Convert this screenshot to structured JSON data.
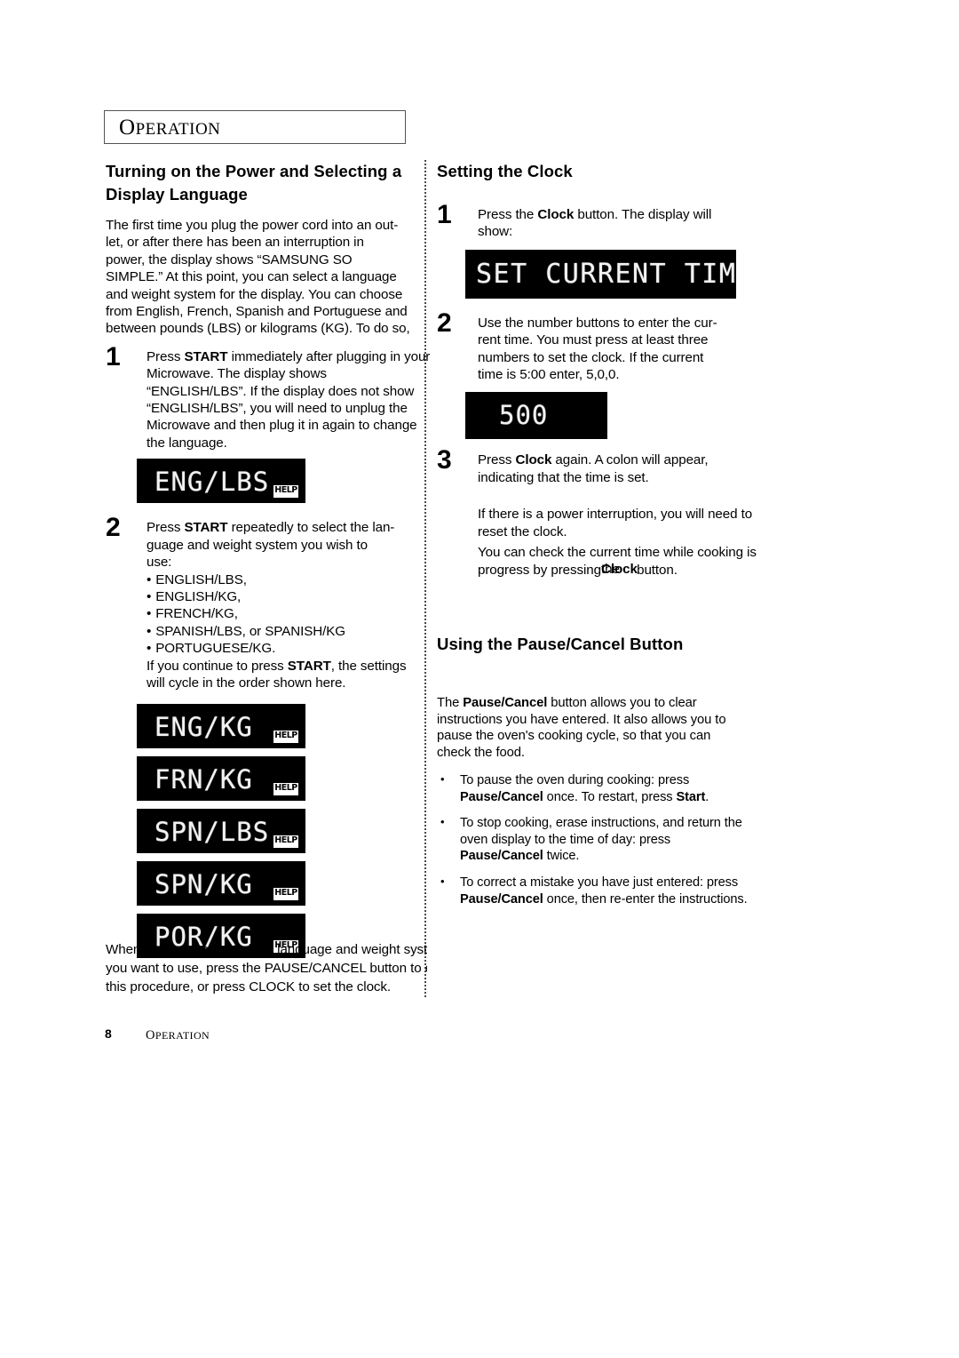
{
  "page": {
    "section_banner": "OPERATION",
    "footer_page_number": "8",
    "footer_section": "OPERATION"
  },
  "left_column": {
    "heading": "Turning on the Power and Selecting a Display Language",
    "intro_paragraph": "The first time you plug the power cord into an outlet, or after there has been an interruption in power, the display shows “SAMSUNG SO SIMPLE.” At this point, you can select a language and weight system for the display. You can choose from English, French, Spanish and Portuguese and between pounds (LBS) or kilograms (KG). To do so,",
    "intro_lines": [
      "The first time you plug the power cord into an out-",
      "let, or after there has been an interruption in",
      "power, the display shows “SAMSUNG SO",
      "SIMPLE.” At this point, you can select a language",
      "and weight system for the display. You can choose",
      "from English, French, Spanish and Portuguese and",
      "between pounds (LBS) or kilograms (KG). To do so,"
    ],
    "step1": {
      "number": "1",
      "line1_pre": "Press ",
      "line1_bold": "START",
      "line1_post": " immediately after plugging in your",
      "lines_rest": [
        "Microwave. The display shows",
        "“ENGLISH/LBS”. If the display does not show",
        "“ENGLISH/LBS”, you will need to unplug the",
        "Microwave and then plug it in again to change",
        "the language."
      ],
      "display": {
        "text": "ENG/LBS",
        "badge": "HELP"
      }
    },
    "step2": {
      "number": "2",
      "line1_pre": "Press ",
      "line1_bold": "START",
      "line1_post": " repeatedly to select the lan-",
      "lines_rest": [
        "guage and weight system you wish to",
        "use:"
      ],
      "options": [
        "ENGLISH/LBS,",
        "ENGLISH/KG,",
        "FRENCH/KG,",
        "SPANISH/LBS, or  SPANISH/KG",
        "PORTUGUESE/KG."
      ],
      "cycle_note_pre": "If you continue to press ",
      "cycle_note_bold": "START",
      "cycle_note_post": ", the settings",
      "cycle_note_line2": "will cycle in the order shown here.",
      "displays": [
        {
          "text": "ENG/KG",
          "badge": "HELP"
        },
        {
          "text": "FRN/KG",
          "badge": "HELP"
        },
        {
          "text": "SPN/LBS",
          "badge": "HELP"
        },
        {
          "text": "SPN/KG",
          "badge": "HELP"
        },
        {
          "text": "POR/KG",
          "badge": "HELP"
        }
      ]
    },
    "closing_lines": [
      "When you have selected the language and weight system",
      "you want to use, press the PAUSE/CANCEL button to end",
      "this procedure, or press CLOCK to set the clock."
    ]
  },
  "right_column": {
    "clock_section": {
      "heading": "Setting the Clock",
      "step1": {
        "number": "1",
        "line1_pre": "Press the ",
        "line1_bold": "Clock",
        "line1_post": " button.  The display will",
        "line2": "show:",
        "display": {
          "text": "SET CURRENT TIME"
        }
      },
      "step2": {
        "number": "2",
        "lines": [
          "Use the number buttons to enter the cur-",
          "rent time. You must press at least three",
          "numbers to set the clock. If the current",
          "time is 5:00 enter, 5,0,0."
        ],
        "display": {
          "text": "500"
        }
      },
      "step3": {
        "number": "3",
        "line1_pre": "Press ",
        "line1_bold": "Clock",
        "line1_post": " again. A colon will appear,",
        "line2": "indicating that the time is set."
      },
      "note_lines": [
        "If there is a power interruption, you will need to",
        "reset the clock."
      ],
      "check_line1": "You can check the current time while cooking is",
      "check_line2_pre": "progress by pressing",
      "check_overlap_a": "the",
      "check_overlap_b": "Clock",
      "check_line2_post": " button."
    },
    "pause_section": {
      "heading": "Using the Pause/Cancel Button",
      "intro_pre": "The ",
      "intro_bold": "Pause/Cancel",
      "intro_post": " button allows you to clear",
      "intro_lines_rest": [
        "instructions you have entered.  It also allows you to",
        "pause the oven's cooking cycle, so that you can",
        "check the food."
      ],
      "bullets": [
        {
          "line1": "To pause the oven during cooking: press",
          "line2_bold1": "Pause/Cancel",
          "line2_mid": " once. To restart, press ",
          "line2_bold2": "Start",
          "line2_post": "."
        },
        {
          "line1": "To stop cooking, erase instructions, and return the",
          "line2": "oven display to the time of day: press",
          "line3_bold": "Pause/Cancel",
          "line3_post": " twice."
        },
        {
          "line1": "To correct a mistake you have just entered: press",
          "line2_bold": "Pause/Cancel",
          "line2_post": " once, then re-enter the instructions."
        }
      ]
    }
  }
}
